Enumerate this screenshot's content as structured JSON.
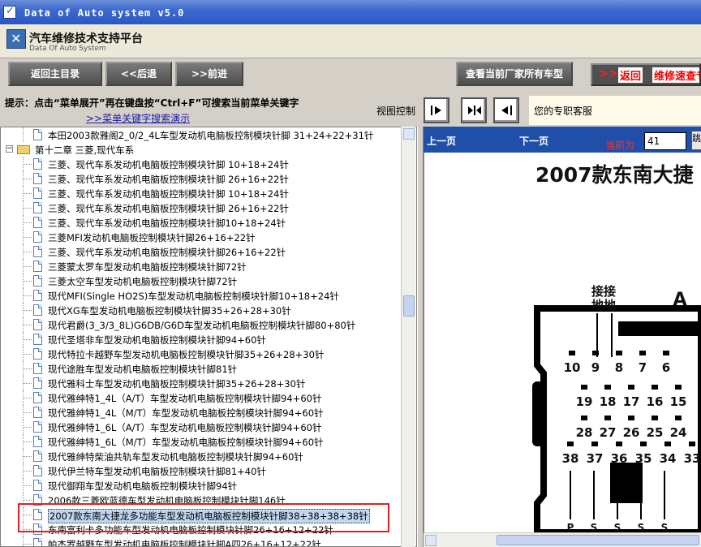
{
  "window": {
    "title": "Data of Auto system v5.0"
  },
  "brand": {
    "title": "汽车维修技术支持平台",
    "subtitle": "Data Of Auto System"
  },
  "toolbar": {
    "home_label": "返回主目录",
    "back_label": "<<后退",
    "forward_label": ">>前进",
    "view_all_label": "查看当前厂家所有车型",
    "banner_chev": ">>",
    "banner_return": "返回",
    "banner_text": "维修速查专"
  },
  "hint": {
    "line1": "提示：点击“菜单展开”再在键盘按“Ctrl+F”可搜索当前菜单关键字",
    "link": ">>菜单关键字搜索演示",
    "view_control": "视图控制",
    "service": "您的专职客服"
  },
  "tree": {
    "top_item": "本田2003款雅阁2_0/2_4L车型发动机电脑板控制模块针脚 31+24+22+31针",
    "folder": {
      "expander": "−",
      "label": "第十二章 三菱,现代车系"
    },
    "items": [
      "三菱、现代车系发动机电脑板控制模块针脚 10+18+24针",
      "三菱、现代车系发动机电脑板控制模块针脚 26+16+22针",
      "三菱、现代车系发动机电脑板控制模块针脚 10+18+24针",
      "三菱、现代车系发动机电脑板控制模块针脚 26+16+22针",
      "三菱、现代车系发动机电脑板控制模块针脚10+18+24针",
      "三菱MFI发动机电脑板控制模块针脚26+16+22针",
      "三菱、现代车系发动机电脑板控制模块针脚26+16+22针",
      "三菱蒙太罗车型发动机电脑板控制模块针脚72针",
      "三菱太空车型发动机电脑板控制模块针脚72针",
      "现代MFI(Single HO2S)车型发动机电脑板控制模块针脚10+18+24针",
      "现代XG车型发动机电脑板控制模块针脚35+26+28+30针",
      "现代君爵(3_3/3_8L)G6DB/G6D车型发动机电脑板控制模块针脚80+80针",
      "现代圣塔非车型发动机电脑板控制模块针脚94+60针",
      "现代特拉卡越野车型发动机电脑板控制模块针脚35+26+28+30针",
      "现代途胜车型发动机电脑板控制模块针脚81针",
      "现代雅科士车型发动机电脑板控制模块针脚35+26+28+30针",
      "现代雅绅特1_4L（A/T）车型发动机电脑板控制模块针脚94+60针",
      "现代雅绅特1_4L（M/T）车型发动机电脑板控制模块针脚94+60针",
      "现代雅绅特1_6L（A/T）车型发动机电脑板控制模块针脚94+60针",
      "现代雅绅特1_6L（M/T）车型发动机电脑板控制模块针脚94+60针",
      "现代雅绅特柴油共轨车型发动机电脑板控制模块针脚94+60针",
      "现代伊兰特车型发动机电脑板控制模块针脚81+40针",
      "现代御翔车型发动机电脑板控制模块针脚94针",
      "2006款三菱欧蓝德车型发动机电脑板控制模块针脚146针",
      "2007款东南大捷龙多功能车型发动机电脑板控制模块针脚38+38+38+38针",
      "东南富利卡多功能车型发动机电脑板控制模块针脚26+16+12+22针",
      "帕杰罗越野车型发动机电脑板控制模块针脚A四26+16+12+22针"
    ],
    "selected_index": 24
  },
  "viewer": {
    "prev_label": "上一页",
    "next_label": "下一页",
    "current_label": "当前为",
    "page_value": "41",
    "go_label": "跳",
    "page_title": "2007款东南大捷",
    "diagram": {
      "ground_label_1": "接接",
      "ground_label_2": "地地",
      "connector_letter": "A",
      "row1": [
        "10",
        "9",
        "8",
        "7",
        "6"
      ],
      "row2": [
        "19",
        "18",
        "17",
        "16",
        "15"
      ],
      "row3": [
        "28",
        "27",
        "26",
        "25",
        "24"
      ],
      "row4": [
        "38",
        "37",
        "36",
        "35",
        "34",
        "33"
      ],
      "bottom_labels": [
        "P",
        "S",
        "S",
        "S",
        "S"
      ]
    }
  }
}
